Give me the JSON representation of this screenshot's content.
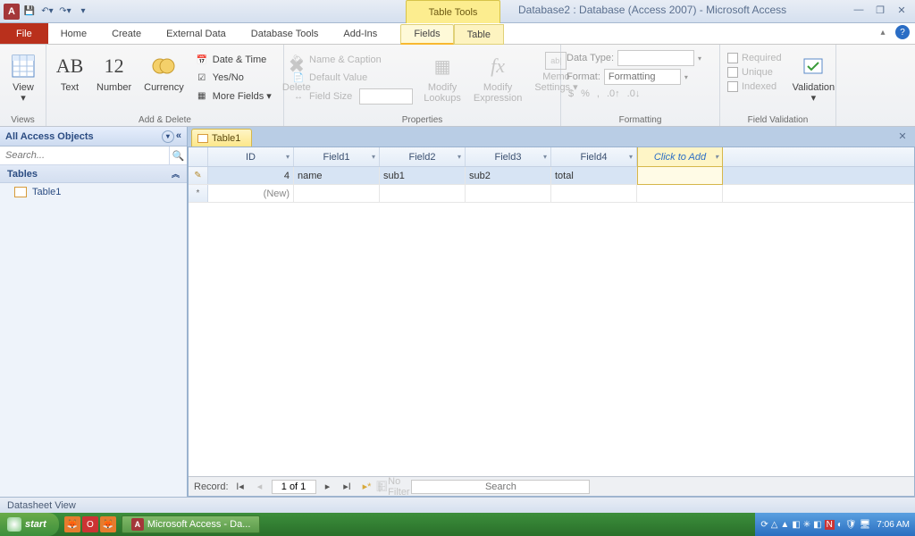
{
  "title": {
    "contextual": "Table Tools",
    "app": "Database2 : Database (Access 2007) - Microsoft Access"
  },
  "tabs": {
    "file": "File",
    "items": [
      "Home",
      "Create",
      "External Data",
      "Database Tools",
      "Add-Ins"
    ],
    "ctx": [
      "Fields",
      "Table"
    ],
    "activeCtx": 0
  },
  "ribbon": {
    "views": {
      "label": "Views",
      "view": "View"
    },
    "addDelete": {
      "label": "Add & Delete",
      "text": "Text",
      "number": "Number",
      "currency": "Currency",
      "dateTime": "Date & Time",
      "yesNo": "Yes/No",
      "moreFields": "More Fields ▾",
      "delete": "Delete",
      "ab": "AB",
      "twelve": "12"
    },
    "properties": {
      "label": "Properties",
      "nameCaption": "Name & Caption",
      "defaultValue": "Default Value",
      "fieldSize": "Field Size",
      "modifyLookups": "Modify\nLookups",
      "modifyExpression": "Modify\nExpression",
      "memoSettings": "Memo\nSettings ▾"
    },
    "formatting": {
      "label": "Formatting",
      "dataType": "Data Type:",
      "format": "Format:",
      "formattingTxt": "Formatting",
      "currency": "$",
      "percent": "%",
      "comma": ",",
      "inc": ".0↑",
      "dec": ".0↓"
    },
    "validation": {
      "label": "Field Validation",
      "required": "Required",
      "unique": "Unique",
      "indexed": "Indexed",
      "validation": "Validation"
    }
  },
  "nav": {
    "header": "All Access Objects",
    "searchPlaceholder": "Search...",
    "group": "Tables",
    "items": [
      "Table1"
    ]
  },
  "doc": {
    "tab": "Table1"
  },
  "grid": {
    "columns": [
      "ID",
      "Field1",
      "Field2",
      "Field3",
      "Field4"
    ],
    "addCol": "Click to Add",
    "rows": [
      {
        "id": "4",
        "cells": [
          "name",
          "sub1",
          "sub2",
          "total",
          ""
        ]
      }
    ],
    "newRow": "(New)"
  },
  "recnav": {
    "label": "Record:",
    "pos": "1 of 1",
    "noFilter": "No Filter",
    "search": "Search"
  },
  "status": "Datasheet View",
  "taskbar": {
    "start": "start",
    "task": "Microsoft Access - Da...",
    "clock": "7:06 AM"
  }
}
